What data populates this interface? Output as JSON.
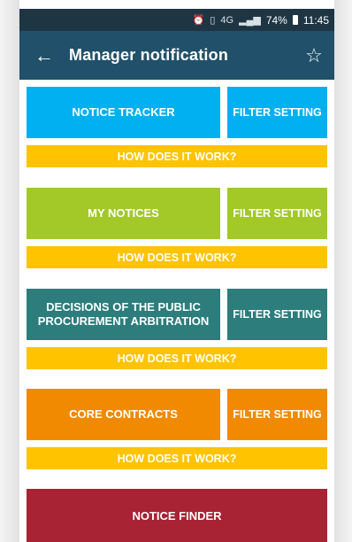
{
  "status_bar": {
    "icons": [
      "alarm-icon",
      "vibrate-icon",
      "network-4g-icon",
      "signal-icon",
      "battery-icon"
    ],
    "network_label": "4G",
    "battery": "74%",
    "time": "11:45"
  },
  "app_bar": {
    "title": "Manager notification",
    "back_icon": "←",
    "favorite_icon": "☆"
  },
  "colors": {
    "status_bar": "#1e3544",
    "app_bar": "#21506a",
    "notice_tracker": "#00b0f0",
    "my_notices": "#a2c928",
    "decisions": "#2c7d7c",
    "core_contracts": "#f18a00",
    "how_it_works": "#ffc300",
    "notice_finder": "#a82333"
  },
  "sections": [
    {
      "main_label": "NOTICE TRACKER",
      "filter_label": "FILTER SETTING",
      "help_label": "HOW DOES IT WORK?"
    },
    {
      "main_label": "MY NOTICES",
      "filter_label": "FILTER SETTING",
      "help_label": "HOW DOES IT WORK?"
    },
    {
      "main_label": "DECISIONS OF THE PUBLIC PROCUREMENT ARBITRATION",
      "filter_label": "FILTER SETTING",
      "help_label": "HOW DOES IT WORK?"
    },
    {
      "main_label": "CORE CONTRACTS",
      "filter_label": "FILTER SETTING",
      "help_label": "HOW DOES IT WORK?"
    }
  ],
  "notice_finder": {
    "label": "NOTICE FINDER"
  }
}
